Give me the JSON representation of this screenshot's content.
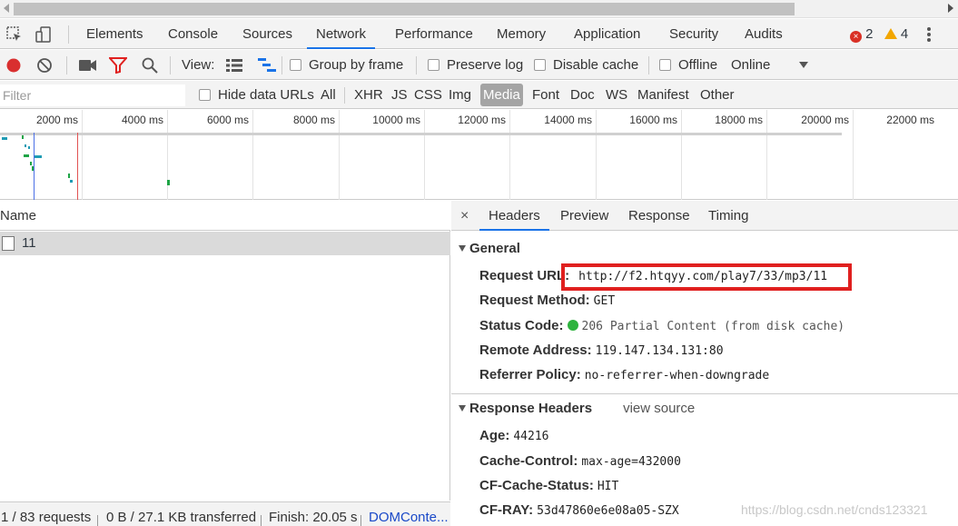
{
  "tabs": [
    "Elements",
    "Console",
    "Sources",
    "Network",
    "Performance",
    "Memory",
    "Application",
    "Security",
    "Audits"
  ],
  "active_tab": "Network",
  "badges": {
    "errors": "2",
    "warnings": "4"
  },
  "toolbar": {
    "view_label": "View:",
    "group_by_frame": "Group by frame",
    "preserve_log": "Preserve log",
    "disable_cache": "Disable cache",
    "offline": "Offline",
    "throttle": "Online"
  },
  "filter": {
    "placeholder": "Filter",
    "hide_data_urls": "Hide data URLs",
    "types": [
      "All",
      "XHR",
      "JS",
      "CSS",
      "Img",
      "Media",
      "Font",
      "Doc",
      "WS",
      "Manifest",
      "Other"
    ],
    "active_type": "Media"
  },
  "overview": {
    "ticks": [
      "2000 ms",
      "4000 ms",
      "6000 ms",
      "8000 ms",
      "10000 ms",
      "12000 ms",
      "14000 ms",
      "16000 ms",
      "18000 ms",
      "20000 ms",
      "22000 ms"
    ]
  },
  "requests": {
    "column": "Name",
    "rows": [
      {
        "name": "11"
      }
    ]
  },
  "details": {
    "tabs": [
      "Headers",
      "Preview",
      "Response",
      "Timing"
    ],
    "active_tab": "Headers",
    "close": "×",
    "general_title": "General",
    "general": [
      {
        "k": "Request URL:",
        "v": "http://f2.htqyy.com/play7/33/mp3/11"
      },
      {
        "k": "Request Method:",
        "v": "GET"
      },
      {
        "k": "Status Code:",
        "v": "206 Partial Content (from disk cache)"
      },
      {
        "k": "Remote Address:",
        "v": "119.147.134.131:80"
      },
      {
        "k": "Referrer Policy:",
        "v": "no-referrer-when-downgrade"
      }
    ],
    "response_title": "Response Headers",
    "view_source": "view source",
    "response": [
      {
        "k": "Age:",
        "v": "44216"
      },
      {
        "k": "Cache-Control:",
        "v": "max-age=432000"
      },
      {
        "k": "CF-Cache-Status:",
        "v": "HIT"
      },
      {
        "k": "CF-RAY:",
        "v": "53d47860e6e08a05-SZX"
      }
    ]
  },
  "status": {
    "requests": "1 / 83 requests",
    "transferred": "0 B / 27.1 KB transferred",
    "finish": "Finish: 20.05 s",
    "dcl": "DOMConte..."
  },
  "watermark": "https://blog.csdn.net/cnds123321",
  "colors": {
    "accent": "#1a73e8",
    "error": "#d93025",
    "record": "#d92f2f",
    "highlight": "#e0201f",
    "status_ok": "#2eb33e"
  }
}
